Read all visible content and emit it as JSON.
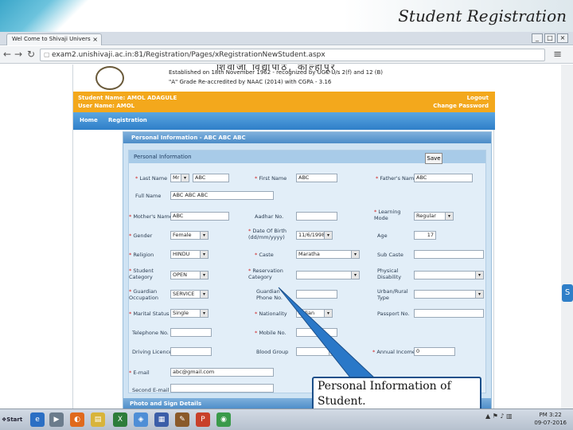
{
  "slide": {
    "title": "Student Registration"
  },
  "browser": {
    "tab_title": "Wel Come to Shivaji Univers",
    "tab_close": "×",
    "url": "exam2.unishivaji.ac.in:81/Registration/Pages/xRegistrationNewStudent.aspx",
    "window_min": "_",
    "window_max": "□",
    "window_close": "×"
  },
  "site": {
    "univ_heading": "शिवाजी विद्यापीठ, कोल्हापूर",
    "estab_line": "Established on 18th November 1962 - recognized by UGC U/s 2(f) and 12 (B)",
    "grade_line": "\"A\" Grade Re-accredited by NAAC (2014) with CGPA - 3.16",
    "student_name": "Student Name: AMOL ADAGULE",
    "user_name": "User Name: AMOL",
    "logout": "Logout",
    "change_password": "Change Password",
    "nav": [
      "Home",
      "Registration"
    ]
  },
  "form": {
    "panel_title": "Personal Information - ABC ABC ABC",
    "sub_title": "Personal Information",
    "save_label": "Save",
    "section2_title": "Photo and Sign Details",
    "fields": {
      "last_name_label": "Last Name",
      "last_name_prefix": "Mr",
      "last_name_value": "ABC",
      "first_name_label": "First Name",
      "first_name_value": "ABC",
      "fathers_name_label": "Father's Name",
      "fathers_name_value": "ABC",
      "full_name_label": "Full Name",
      "full_name_value": "ABC ABC ABC",
      "mothers_name_label": "Mother's Name",
      "mothers_name_value": "ABC",
      "aadhar_label": "Aadhar No.",
      "learning_mode_label": "Learning Mode",
      "learning_mode_value": "Regular",
      "gender_label": "Gender",
      "gender_value": "Female",
      "dob_label": "Date Of Birth (dd/mm/yyyy)",
      "dob_value": "11/6/1998",
      "age_label": "Age",
      "age_value": "17",
      "religion_label": "Religion",
      "religion_value": "HINDU",
      "caste_label": "Caste",
      "caste_value": "Maratha",
      "sub_caste_label": "Sub Caste",
      "student_category_label": "Student Category",
      "student_category_value": "OPEN",
      "reservation_category_label": "Reservation Category",
      "physical_disability_label": "Physical Disability",
      "guardian_occupation_label": "Guardian Occupation",
      "guardian_occupation_value": "SERVICE",
      "guardian_phone_label": "Guardian Phone No.",
      "urban_rural_label": "Urban/Rural Type",
      "marital_status_label": "Marital Status",
      "marital_status_value": "Single",
      "nationality_label": "Nationality",
      "nationality_value": "Indian",
      "passport_label": "Passport No.",
      "telephone_label": "Telephone No.",
      "mobile_label": "Mobile No.",
      "driving_licence_label": "Driving Licence",
      "blood_group_label": "Blood Group",
      "annual_income_label": "Annual Income",
      "annual_income_value": "0",
      "email_label": "E-mail",
      "email_value": "abc@gmail.com",
      "second_email_label": "Second E-mail"
    }
  },
  "callout": {
    "text": "Personal Information of Student."
  },
  "taskbar": {
    "start_label": "Start",
    "clock_time": "PM 3:22",
    "clock_date": "09-07-2016"
  }
}
